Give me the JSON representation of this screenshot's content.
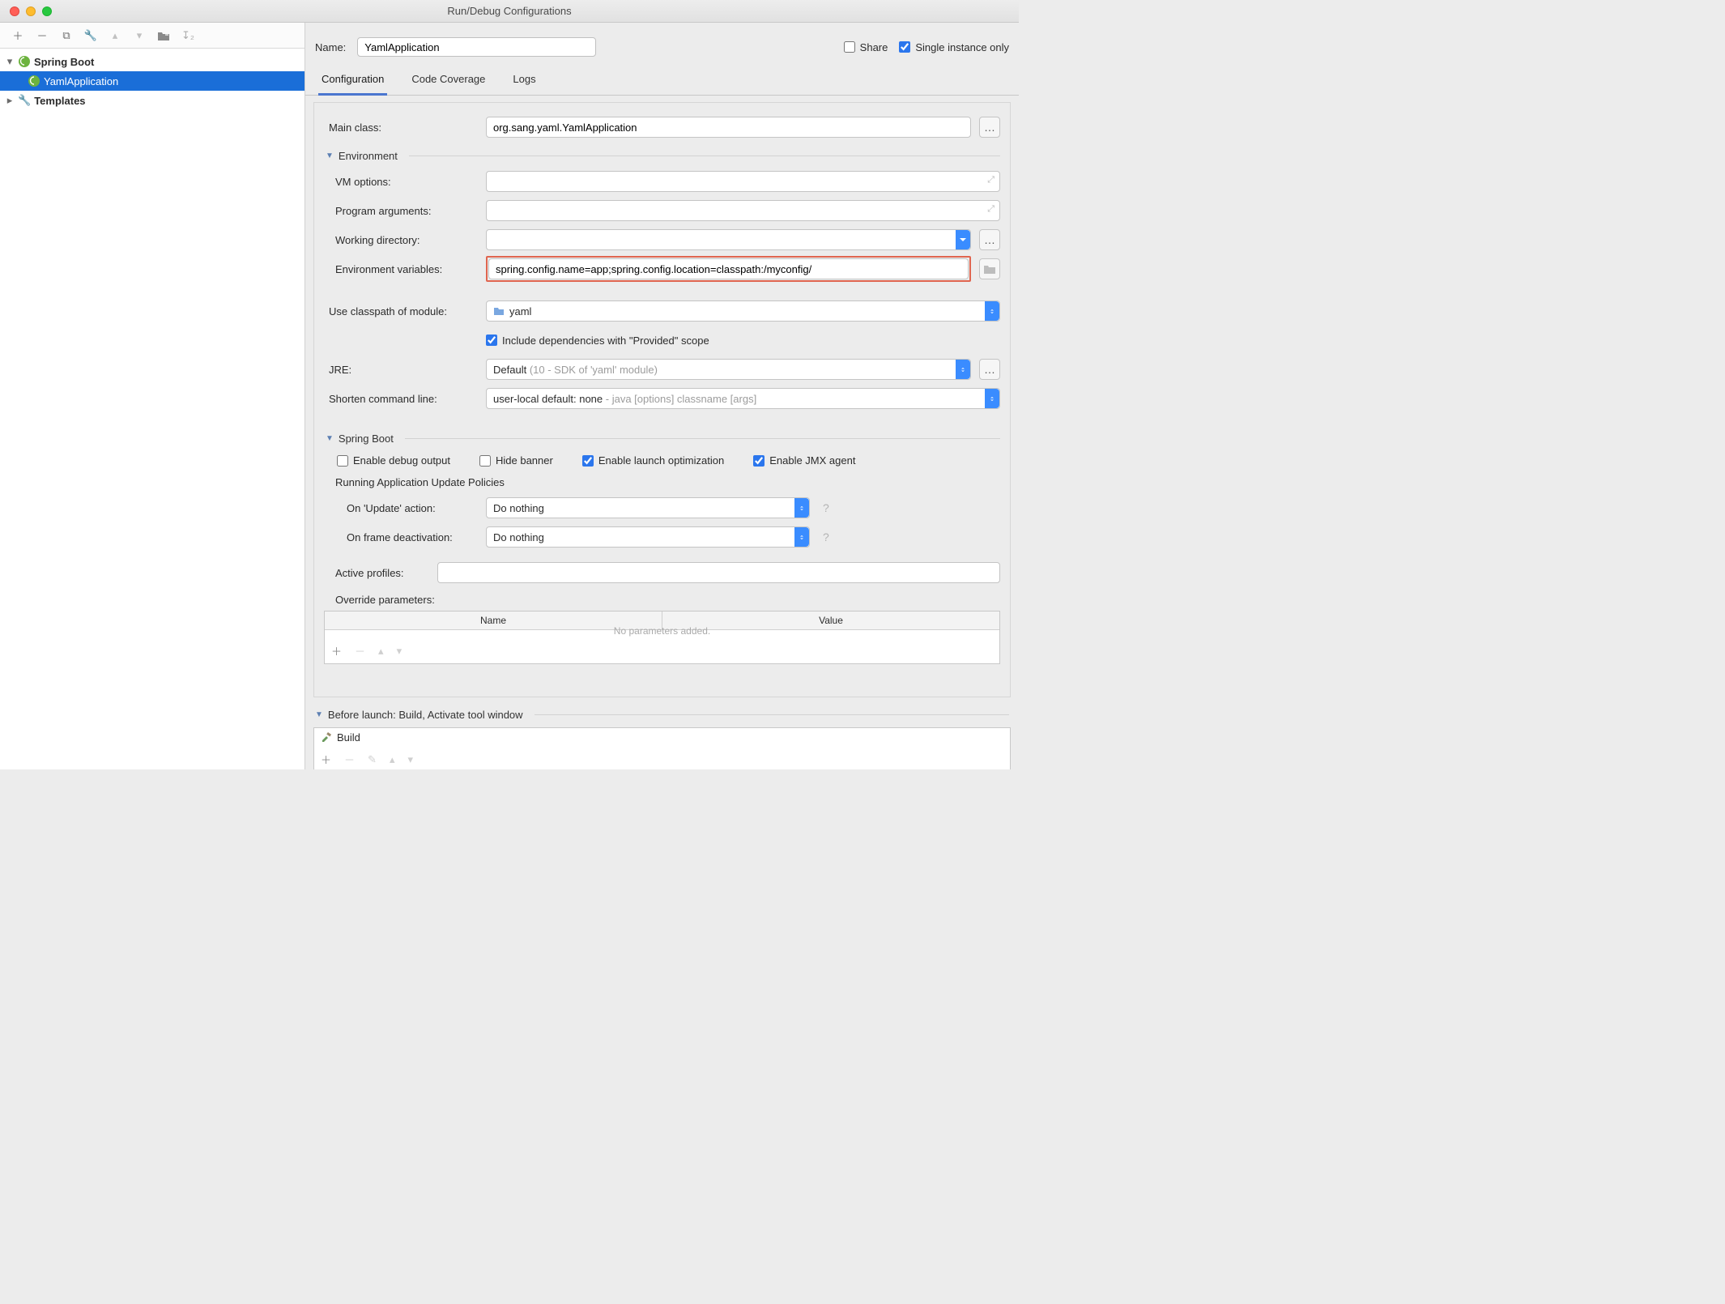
{
  "window": {
    "title": "Run/Debug Configurations"
  },
  "name_row": {
    "label": "Name:",
    "value": "YamlApplication",
    "share_label": "Share",
    "single_instance_label": "Single instance only",
    "share_checked": false,
    "single_instance_checked": true
  },
  "tabs": {
    "config": "Configuration",
    "coverage": "Code Coverage",
    "logs": "Logs"
  },
  "tree": {
    "springboot": "Spring Boot",
    "app": "YamlApplication",
    "templates": "Templates"
  },
  "labels": {
    "main_class": "Main class:",
    "environment": "Environment",
    "vm_options": "VM options:",
    "program_args": "Program arguments:",
    "working_dir": "Working directory:",
    "env_vars": "Environment variables:",
    "classpath_module": "Use classpath of module:",
    "include_provided": "Include dependencies with \"Provided\" scope",
    "jre": "JRE:",
    "shorten_cmd": "Shorten command line:",
    "spring_boot": "Spring Boot",
    "enable_debug": "Enable debug output",
    "hide_banner": "Hide banner",
    "enable_launch_opt": "Enable launch optimization",
    "enable_jmx": "Enable JMX agent",
    "update_policies": "Running Application Update Policies",
    "on_update": "On 'Update' action:",
    "on_frame": "On frame deactivation:",
    "active_profiles": "Active profiles:",
    "override_params": "Override parameters:",
    "col_name": "Name",
    "col_value": "Value",
    "no_params": "No parameters added.",
    "before_launch": "Before launch: Build, Activate tool window",
    "build": "Build"
  },
  "values": {
    "main_class": "org.sang.yaml.YamlApplication",
    "vm_options": "",
    "program_args": "",
    "working_dir": "",
    "env_vars": "spring.config.name=app;spring.config.location=classpath:/myconfig/",
    "classpath_module": "yaml",
    "include_provided_checked": true,
    "jre_prefix": "Default ",
    "jre_dim": "(10 - SDK of 'yaml' module)",
    "shorten_prefix": "user-local default: none ",
    "shorten_dim": "- java [options] classname [args]",
    "enable_debug_checked": false,
    "hide_banner_checked": false,
    "enable_launch_opt_checked": true,
    "enable_jmx_checked": true,
    "on_update": "Do nothing",
    "on_frame": "Do nothing",
    "active_profiles": ""
  }
}
